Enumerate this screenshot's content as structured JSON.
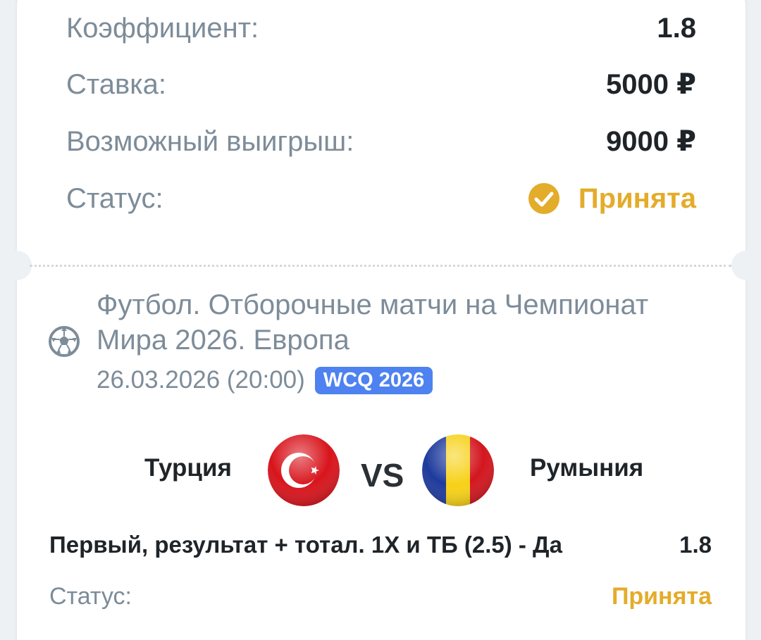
{
  "summary": {
    "odds_label": "Коэффициент:",
    "odds_value": "1.8",
    "stake_label": "Ставка:",
    "stake_value": "5000 ₽",
    "payout_label": "Возможный выигрыш:",
    "payout_value": "9000 ₽",
    "status_label": "Статус:",
    "status_value": "Принята",
    "status_icon": "check-circle-icon"
  },
  "event": {
    "sport_icon": "soccer-ball-icon",
    "title_line1": "Футбол. Отборочные матчи на Чемпионат",
    "title_line2": "Мира 2026. Европа",
    "datetime": "26.03.2026 (20:00)",
    "badge": "WCQ 2026"
  },
  "match": {
    "home_team": "Турция",
    "home_flag": "turkey-flag-icon",
    "vs_label": "VS",
    "away_team": "Румыния",
    "away_flag": "romania-flag-icon"
  },
  "bet": {
    "description": "Первый, результат + тотал. 1X и ТБ (2.5) - Да",
    "odds": "1.8",
    "status_label": "Статус:",
    "status_value": "Принята"
  },
  "colors": {
    "accent_status": "#e3ac2a",
    "badge_blue": "#4d82f0",
    "muted_text": "#7d8c99",
    "strong_text": "#1f2429"
  }
}
